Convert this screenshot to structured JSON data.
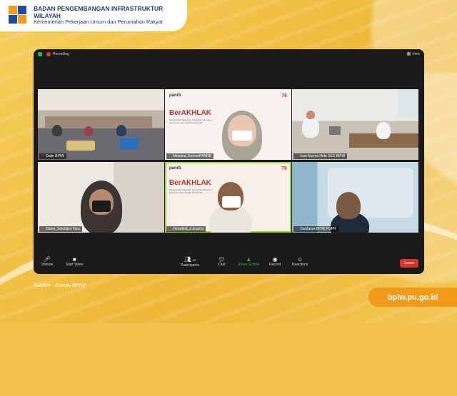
{
  "header": {
    "org_title": "BADAN PENGEMBANGAN INFRASTRUKTUR WILAYAH",
    "org_subtitle": "Kementerian Pekerjaan Umum dan Perumahan Rakyat",
    "logo_icon": "bpiw-logo"
  },
  "zoom": {
    "recording_label": "Recording",
    "view_label": "View",
    "tiles": [
      {
        "name": "Datin BPIW",
        "muted": true
      },
      {
        "name": "Nirwana_KemenPANRB",
        "muted": true
      },
      {
        "name": "Ivan Nurma Hida SES BPIW",
        "muted": true
      },
      {
        "name": "Diana_Sekditjen Taru",
        "muted": true
      },
      {
        "name": "Heradinb_d anama",
        "muted": true
      },
      {
        "name": "Dwidarsa-BPIW PUPR",
        "muted": true
      }
    ],
    "slide": {
      "brand": "panrb",
      "anniv": "76",
      "headline": "BerAKHLAK",
      "sub": "Berorientasi Pelayanan Akuntabel Kompeten Harmonis Loyal Adaptif Kolaboratif"
    },
    "toolbar": {
      "unmute": "Unmute",
      "start_video": "Start Video",
      "participants": "Participants",
      "participants_count": "39",
      "chat": "Chat",
      "share_screen": "Share Screen",
      "record": "Record",
      "reactions": "Reactions",
      "leave": "Leave"
    },
    "colors": {
      "leave": "#d9342b",
      "share": "#2dbb55",
      "active_speaker": "#9fd13a"
    }
  },
  "source": "Sumber : Kompu BPIW",
  "website": "bpiw.pu.go.id"
}
